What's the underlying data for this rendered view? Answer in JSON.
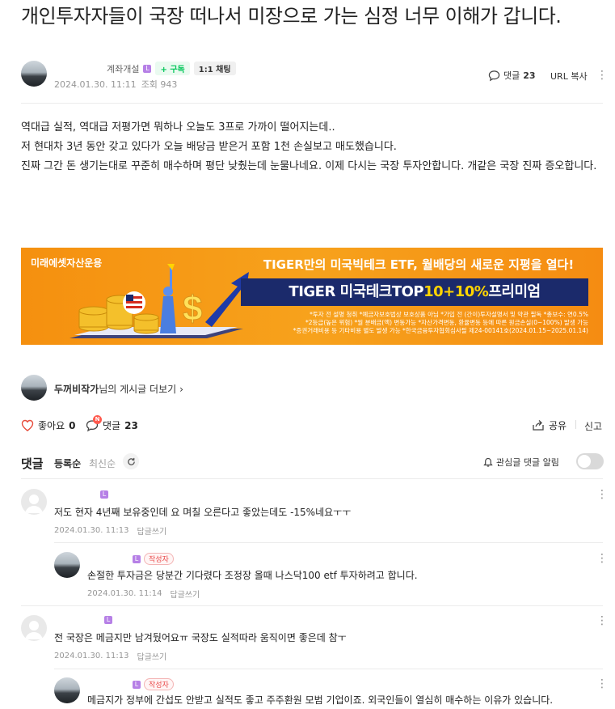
{
  "post": {
    "title": "개인투자자들이 국장 떠나서 미장으로 가는 심정 너무 이해가 갑니다.",
    "author_level": "계좌개설",
    "level_badge": "L",
    "subscribe_label": "+ 구독",
    "chat_label": "1:1 채팅",
    "date": "2024.01.30. 11:11",
    "views": "조회 943",
    "comment_label": "댓글",
    "comment_count": "23",
    "url_copy": "URL 복사",
    "body": [
      "역대급 실적, 역대급 저평가면 뭐하나 오늘도 3프로 가까이 떨어지는데..",
      "저 현대차 3년 동안 갖고 있다가 오늘 배당금 받은거 포함 1천 손실보고 매도했습니다.",
      "진짜 그간 돈 생기는대로 꾸준히 매수하며 평단 낮췄는데 눈물나네요. 이제 다시는 국장 투자안합니다. 개같은 국장 진짜 증오합니다."
    ]
  },
  "banner": {
    "brand": "미래에셋자산운용",
    "headline": "TIGER만의 미국빅테크 ETF, 월배당의 새로운 지평을 열다!",
    "product_main": "TIGER 미국테크TOP",
    "product_accent": "10+10%",
    "product_tail": "프리미엄",
    "fine_1": "*투자 전 설명 청취 *예금자보호법상 보호상품 아님 *가입 전 (간이)투자설명서 및 약관 필독 *총보수: 연0.5%",
    "fine_2": "*2등급(높은 위험) *월 분배금(액) 변동가능 *자산가격변동, 환율변동 등에 따른 원금손실(0~100%) 발생 가능",
    "fine_3": "*증권거래비용 등 기타비용 별도 발생 가능 *한국금융투자협회심사필 제24-00141호(2024.01.15~2025.01.14)"
  },
  "author_more": {
    "name": "두꺼비작가",
    "suffix": "님의 게시글 더보기",
    "chevron": "›"
  },
  "actions": {
    "like_label": "좋아요",
    "like_count": "0",
    "new_badge": "N",
    "comment_label": "댓글",
    "comment_count": "23",
    "share_label": "공유",
    "report_label": "신고"
  },
  "comments_header": {
    "title": "댓글",
    "sort_registered": "등록순",
    "sort_latest": "최신순",
    "watch_label": "관심글 댓글 알림"
  },
  "comments": [
    {
      "text": "저도 현자 4년째 보유중인데 요 며칠 오른다고 좋았는데도 -15%네요ㅜㅜ",
      "date": "2024.01.30. 11:13",
      "reply": "답글쓰기"
    },
    {
      "author_tag": "작성자",
      "text": "손절한 투자금은 당분간 기다렸다 조정장 올때 나스닥100 etf 투자하려고 합니다.",
      "date": "2024.01.30. 11:14",
      "reply": "답글쓰기"
    },
    {
      "text": "전 국장은 메금지만 남겨뒀어요ㅠ 국장도 실적따라 움직이면 좋은데 참ㅜ",
      "date": "2024.01.30. 11:13",
      "reply": "답글쓰기"
    },
    {
      "author_tag": "작성자",
      "text": "메금지가 정부에 간섭도 안받고 실적도 좋고 주주환원 모범 기업이죠. 외국인들이 열심히 매수하는 이유가 있습니다."
    }
  ],
  "icons": {
    "more": "⋮",
    "level": "L"
  },
  "colors": {
    "subscribe_green": "#03c75a",
    "level_purple": "#b680e6",
    "author_tag_red": "#e94b4b",
    "banner_orange": "#f5900f",
    "banner_navy": "#1b2a6b",
    "banner_yellow": "#ffd400"
  }
}
